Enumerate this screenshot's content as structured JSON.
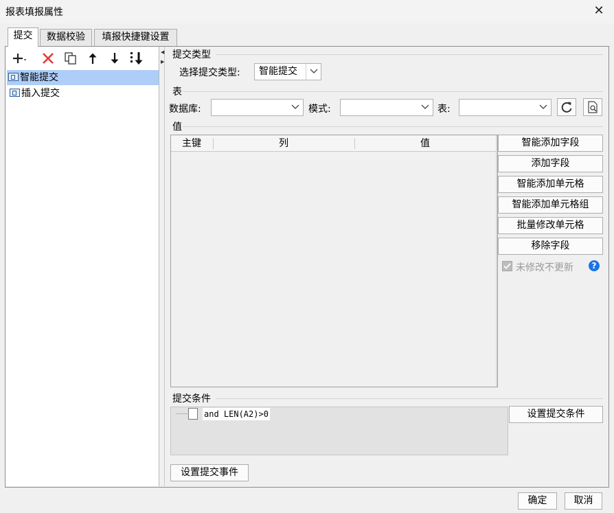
{
  "window": {
    "title": "报表填报属性",
    "close_symbol": "✕"
  },
  "tabs": [
    {
      "label": "提交",
      "active": true
    },
    {
      "label": "数据校验",
      "active": false
    },
    {
      "label": "填报快捷键设置",
      "active": false
    }
  ],
  "toolbar": {
    "icons": [
      "add-icon",
      "delete-icon",
      "copy-icon",
      "move-up-icon",
      "move-down-icon",
      "move-bottom-icon"
    ]
  },
  "tree": {
    "items": [
      {
        "label": "智能提交",
        "selected": true
      },
      {
        "label": "插入提交",
        "selected": false
      }
    ]
  },
  "submit_type": {
    "section_label": "提交类型",
    "field_label": "选择提交类型:",
    "value": "智能提交"
  },
  "table_section": {
    "section_label": "表",
    "database_label": "数据库:",
    "database_value": "",
    "schema_label": "模式:",
    "schema_value": "",
    "table_label": "表:",
    "table_value": ""
  },
  "value_section": {
    "section_label": "值",
    "columns": [
      "主键",
      "列",
      "值"
    ],
    "buttons": [
      "智能添加字段",
      "添加字段",
      "智能添加单元格",
      "智能添加单元格组",
      "批量修改单元格",
      "移除字段"
    ],
    "checkbox_label": "未修改不更新",
    "checkbox_checked": true,
    "help_symbol": "?"
  },
  "condition_section": {
    "section_label": "提交条件",
    "condition_text": "and LEN(A2)>0",
    "set_condition_button": "设置提交条件"
  },
  "set_event_button": "设置提交事件",
  "footer": {
    "ok_label": "确定",
    "cancel_label": "取消"
  },
  "colors": {
    "selection": "#aecdf7",
    "delete_red": "#e53935",
    "help_blue": "#1a73e8"
  }
}
